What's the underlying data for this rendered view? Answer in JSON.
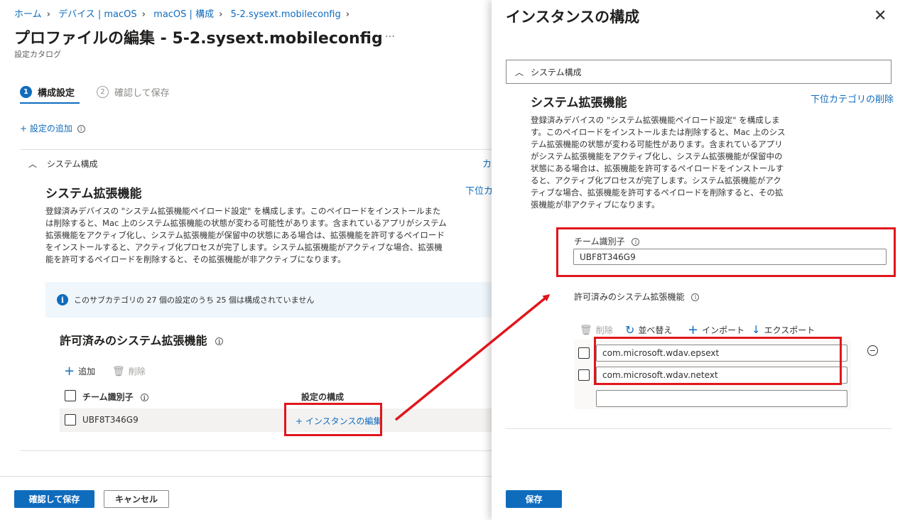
{
  "breadcrumb": [
    "ホーム",
    "デバイス | macOS",
    "macOS | 構成",
    "5-2.sysext.mobileconfig"
  ],
  "page": {
    "title": "プロファイルの編集 - 5-2.sysext.mobileconfig",
    "more": "…",
    "subtitle": "設定カタログ"
  },
  "steps": [
    {
      "num": "1",
      "label": "構成設定"
    },
    {
      "num": "2",
      "label": "確認して保存"
    }
  ],
  "add_setting": "+ 設定の追加",
  "section": {
    "header": "システム構成",
    "title": "システム拡張機能",
    "remove_link_truncated": "下位カ",
    "header_link_truncated": "カ",
    "description": "登録済みデバイスの \"システム拡張機能ペイロード設定\" を構成します。このペイロードをインストールまたは削除すると、Mac 上のシステム拡張機能の状態が変わる可能性があります。含まれているアプリがシステム拡張機能をアクティブ化し、システム拡張機能が保留中の状態にある場合は、拡張機能を許可するペイロードをインストールすると、アクティブ化プロセスが完了します。システム拡張機能がアクティブな場合、拡張機能を許可するペイロードを削除すると、その拡張機能が非アクティブになります。",
    "info_banner": "このサブカテゴリの 27 個の設定のうち 25 個は構成されていません",
    "allowed_title": "許可済みのシステム拡張機能",
    "toolbar": {
      "add": "追加",
      "delete": "削除"
    },
    "table": {
      "headers": [
        "チーム識別子",
        "設定の構成"
      ],
      "rows": [
        {
          "team_id": "UBF8T346G9",
          "action": "+ インスタンスの編集"
        }
      ]
    }
  },
  "footer": {
    "save": "確認して保存",
    "cancel": "キャンセル"
  },
  "panel": {
    "title": "インスタンスの構成",
    "accordion": "システム構成",
    "section_title": "システム拡張機能",
    "remove_link": "下位カテゴリの削除",
    "description": "登録済みデバイスの \"システム拡張機能ペイロード設定\" を構成します。このペイロードをインストールまたは削除すると、Mac 上のシステム拡張機能の状態が変わる可能性があります。含まれているアプリがシステム拡張機能をアクティブ化し、システム拡張機能が保留中の状態にある場合は、拡張機能を許可するペイロードをインストールすると、アクティブ化プロセスが完了します。システム拡張機能がアクティブな場合、拡張機能を許可するペイロードを削除すると、その拡張機能が非アクティブになります。",
    "team_id_label": "チーム識別子",
    "team_id_value": "UBF8T346G9",
    "allowed_label": "許可済みのシステム拡張機能",
    "toolbar": {
      "delete": "削除",
      "sort": "並べ替え",
      "import": "インポート",
      "export": "エクスポート"
    },
    "extensions": [
      "com.microsoft.wdav.epsext",
      "com.microsoft.wdav.netext",
      ""
    ],
    "save": "保存"
  },
  "colors": {
    "accent": "#0f6cbd",
    "annotation_red": "#e0161c"
  }
}
